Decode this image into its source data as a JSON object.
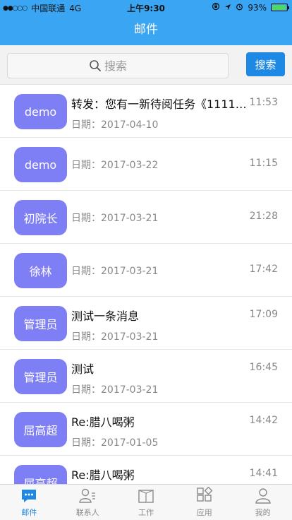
{
  "status_bar": {
    "signal": "●●○○○",
    "carrier": "中国联通",
    "network": "4G",
    "time": "上午9:30",
    "battery_text": "93%",
    "battery_level": 0.93
  },
  "nav": {
    "title": "邮件"
  },
  "search": {
    "placeholder": "搜索",
    "button_label": "搜索"
  },
  "mails": [
    {
      "avatar": "demo",
      "subject": "转发：您有一新待阅任务《11111…",
      "date": "日期：2017-04-10",
      "time": "11:53"
    },
    {
      "avatar": "demo",
      "subject": "",
      "date": "日期：2017-03-22",
      "time": "11:15"
    },
    {
      "avatar": "初院长",
      "subject": "",
      "date": "日期：2017-03-21",
      "time": "21:28"
    },
    {
      "avatar": "徐林",
      "subject": "",
      "date": "日期：2017-03-21",
      "time": "17:42"
    },
    {
      "avatar": "管理员",
      "subject": "测试一条消息",
      "date": "日期：2017-03-21",
      "time": "17:09"
    },
    {
      "avatar": "管理员",
      "subject": "测试",
      "date": "日期：2017-03-21",
      "time": "16:45"
    },
    {
      "avatar": "屈高超",
      "subject": "Re:腊八喝粥",
      "date": "日期：2017-01-05",
      "time": "14:42"
    },
    {
      "avatar": "屈高超",
      "subject": "Re:腊八喝粥",
      "date": "",
      "time": "14:41"
    }
  ],
  "tabs": [
    {
      "label": "邮件",
      "icon": "chat-bubble-icon",
      "active": true
    },
    {
      "label": "联系人",
      "icon": "contacts-icon",
      "active": false
    },
    {
      "label": "工作",
      "icon": "folder-icon",
      "active": false
    },
    {
      "label": "应用",
      "icon": "apps-grid-icon",
      "active": false
    },
    {
      "label": "我的",
      "icon": "person-icon",
      "active": false
    }
  ],
  "colors": {
    "primary": "#3aa6f3",
    "accent": "#1e88e5",
    "avatar": "#7f7ff5"
  }
}
